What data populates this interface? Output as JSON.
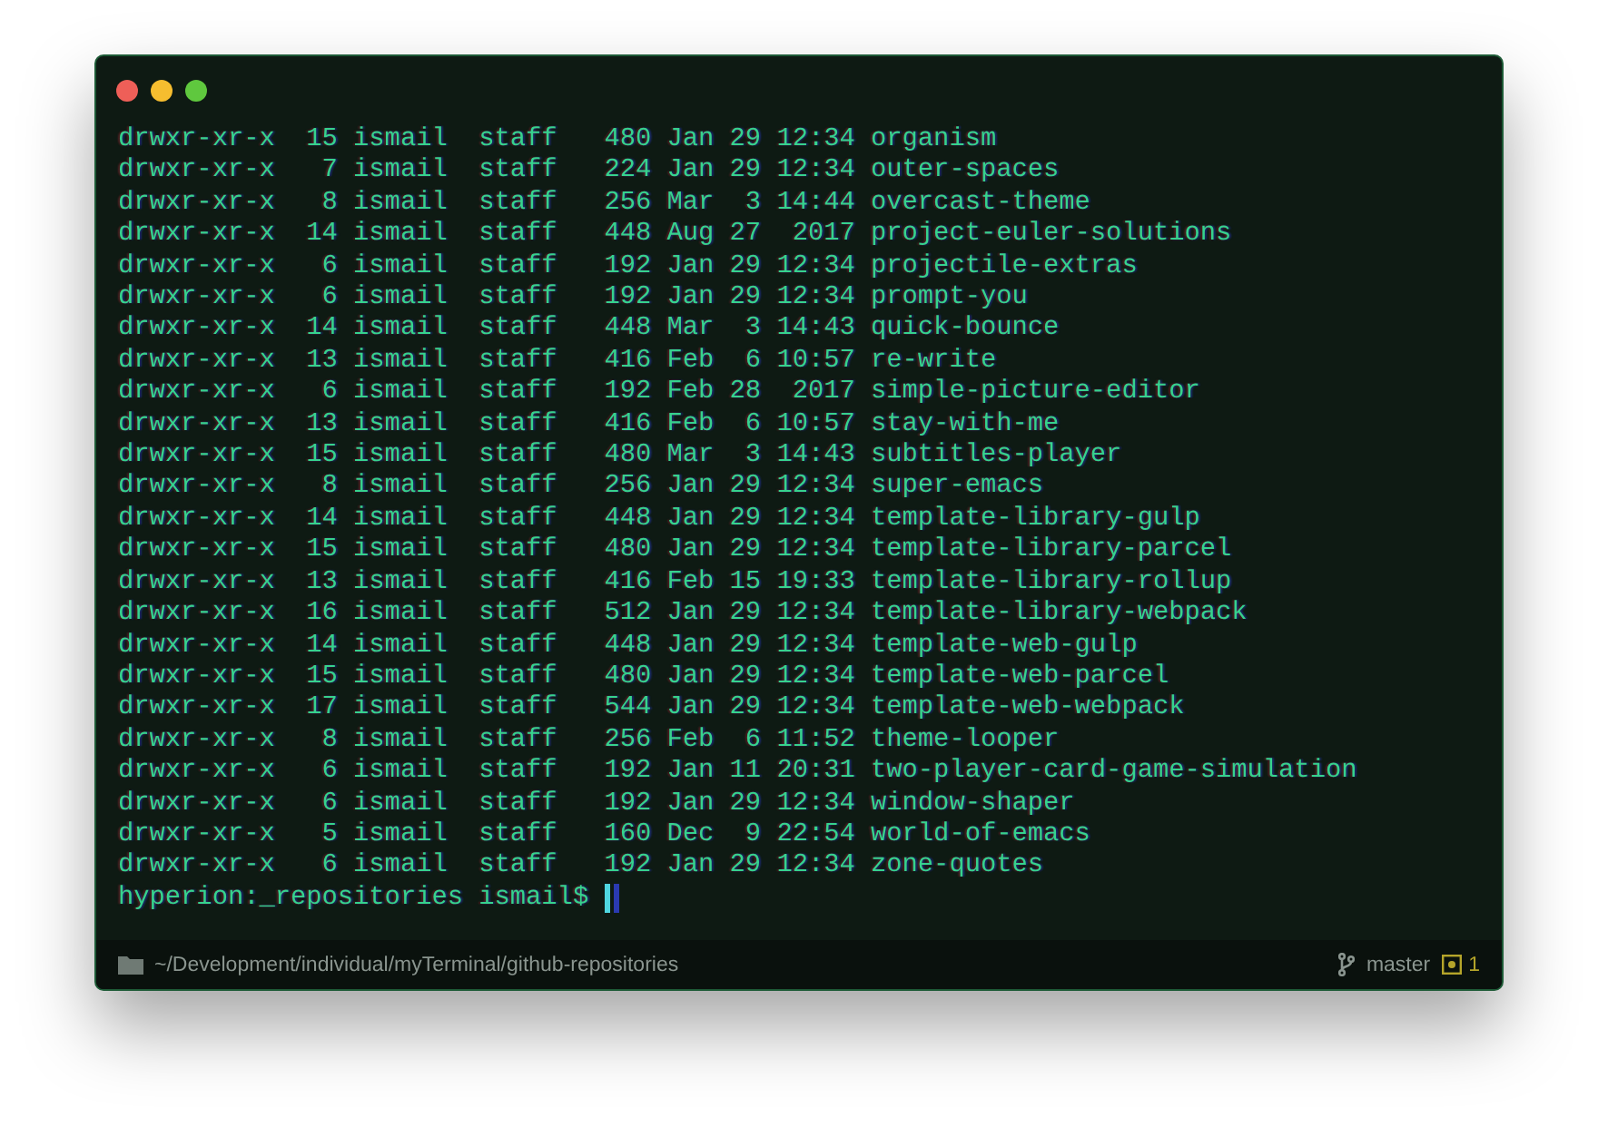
{
  "lines": [
    "drwxr-xr-x  15 ismail  staff   480 Jan 29 12:34 organism",
    "drwxr-xr-x   7 ismail  staff   224 Jan 29 12:34 outer-spaces",
    "drwxr-xr-x   8 ismail  staff   256 Mar  3 14:44 overcast-theme",
    "drwxr-xr-x  14 ismail  staff   448 Aug 27  2017 project-euler-solutions",
    "drwxr-xr-x   6 ismail  staff   192 Jan 29 12:34 projectile-extras",
    "drwxr-xr-x   6 ismail  staff   192 Jan 29 12:34 prompt-you",
    "drwxr-xr-x  14 ismail  staff   448 Mar  3 14:43 quick-bounce",
    "drwxr-xr-x  13 ismail  staff   416 Feb  6 10:57 re-write",
    "drwxr-xr-x   6 ismail  staff   192 Feb 28  2017 simple-picture-editor",
    "drwxr-xr-x  13 ismail  staff   416 Feb  6 10:57 stay-with-me",
    "drwxr-xr-x  15 ismail  staff   480 Mar  3 14:43 subtitles-player",
    "drwxr-xr-x   8 ismail  staff   256 Jan 29 12:34 super-emacs",
    "drwxr-xr-x  14 ismail  staff   448 Jan 29 12:34 template-library-gulp",
    "drwxr-xr-x  15 ismail  staff   480 Jan 29 12:34 template-library-parcel",
    "drwxr-xr-x  13 ismail  staff   416 Feb 15 19:33 template-library-rollup",
    "drwxr-xr-x  16 ismail  staff   512 Jan 29 12:34 template-library-webpack",
    "drwxr-xr-x  14 ismail  staff   448 Jan 29 12:34 template-web-gulp",
    "drwxr-xr-x  15 ismail  staff   480 Jan 29 12:34 template-web-parcel",
    "drwxr-xr-x  17 ismail  staff   544 Jan 29 12:34 template-web-webpack",
    "drwxr-xr-x   8 ismail  staff   256 Feb  6 11:52 theme-looper",
    "drwxr-xr-x   6 ismail  staff   192 Jan 11 20:31 two-player-card-game-simulation",
    "drwxr-xr-x   6 ismail  staff   192 Jan 29 12:34 window-shaper",
    "drwxr-xr-x   5 ismail  staff   160 Dec  9 22:54 world-of-emacs",
    "drwxr-xr-x   6 ismail  staff   192 Jan 29 12:34 zone-quotes"
  ],
  "prompt": "hyperion:_repositories ismail$",
  "status_bar": {
    "path": "~/Development/individual/myTerminal/github-repositories",
    "branch": "master",
    "badge": "1"
  }
}
